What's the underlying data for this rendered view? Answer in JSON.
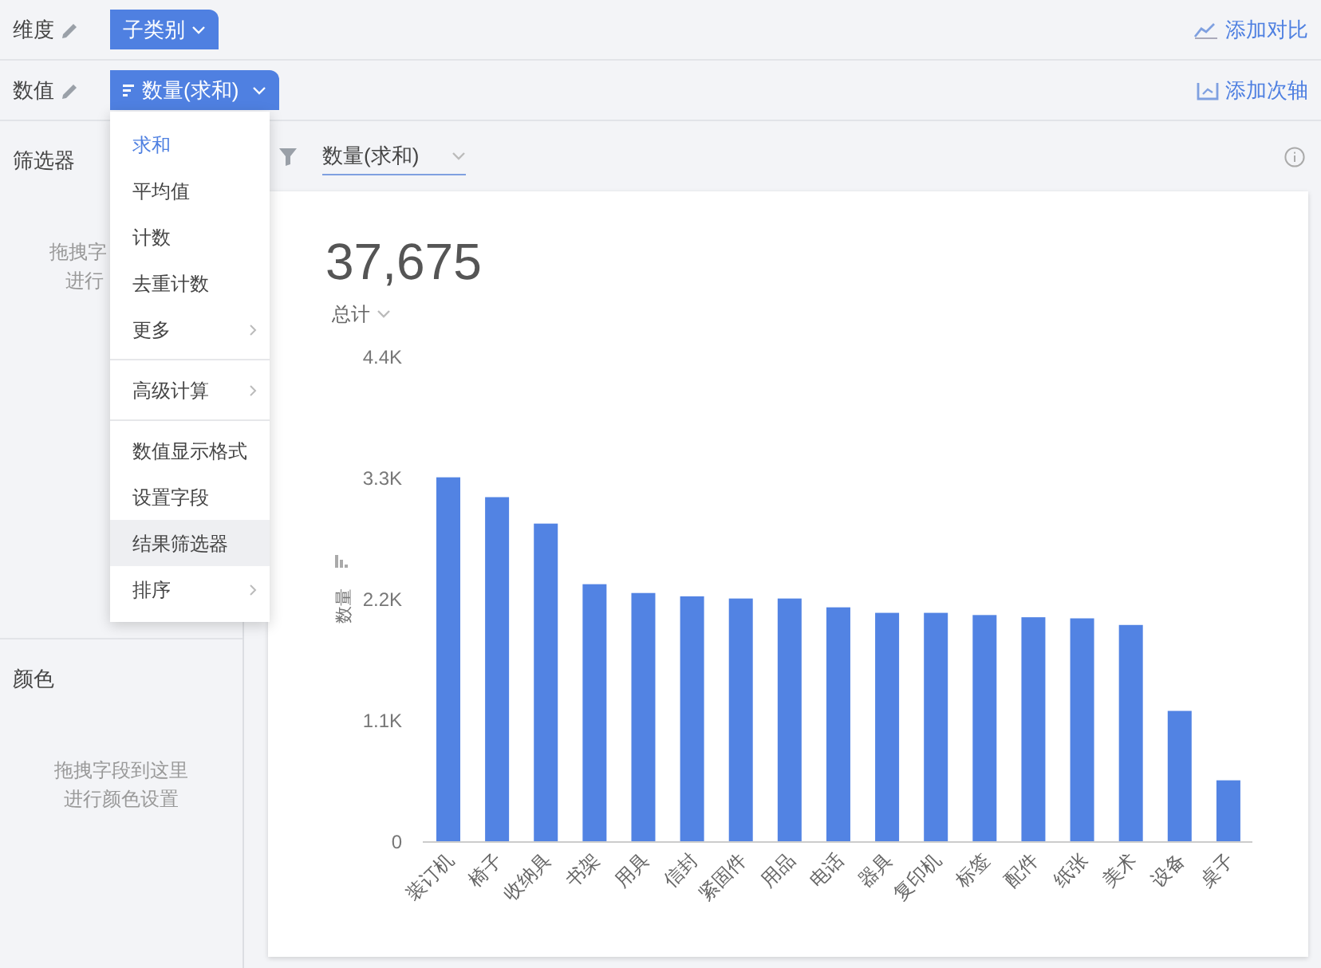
{
  "shelf_rows": [
    {
      "label": "维度",
      "field": "子类别",
      "field_icon": false,
      "action": "添加对比",
      "kind": "compare"
    },
    {
      "label": "数值",
      "field": "数量(求和)",
      "field_icon": true,
      "action": "添加次轴",
      "kind": "axis"
    }
  ],
  "menu": {
    "groups": [
      [
        {
          "label": "求和",
          "selected": true,
          "hovered": false,
          "submenu": false
        },
        {
          "label": "平均值",
          "selected": false,
          "hovered": false,
          "submenu": false
        },
        {
          "label": "计数",
          "selected": false,
          "hovered": false,
          "submenu": false
        },
        {
          "label": "去重计数",
          "selected": false,
          "hovered": false,
          "submenu": false
        },
        {
          "label": "更多",
          "selected": false,
          "hovered": false,
          "submenu": true
        }
      ],
      [
        {
          "label": "高级计算",
          "selected": false,
          "hovered": false,
          "submenu": true
        }
      ],
      [
        {
          "label": "数值显示格式",
          "selected": false,
          "hovered": false,
          "submenu": false
        },
        {
          "label": "设置字段",
          "selected": false,
          "hovered": false,
          "submenu": false
        },
        {
          "label": "结果筛选器",
          "selected": false,
          "hovered": true,
          "submenu": false
        },
        {
          "label": "排序",
          "selected": false,
          "hovered": false,
          "submenu": true
        }
      ]
    ]
  },
  "sidebar": {
    "sections": [
      {
        "title": "筛选器",
        "hint": [
          "拖拽字",
          "进行"
        ]
      },
      {
        "title": "颜色",
        "hint": [
          "拖拽字段到这里",
          "进行颜色设置"
        ]
      }
    ]
  },
  "filter_bar": {
    "field": "数量(求和)"
  },
  "card": {
    "total": "37,675",
    "total_label": "总计",
    "chart_data": {
      "type": "bar",
      "ylabel": "数量",
      "categories": [
        "装订机",
        "椅子",
        "收纳具",
        "书架",
        "用具",
        "信封",
        "紧固件",
        "用品",
        "电话",
        "器具",
        "复印机",
        "标签",
        "配件",
        "纸张",
        "美术",
        "设备",
        "桌子"
      ],
      "values": [
        3310,
        3130,
        2890,
        2340,
        2260,
        2230,
        2210,
        2210,
        2130,
        2080,
        2080,
        2060,
        2040,
        2030,
        1970,
        1190,
        560
      ],
      "ylim": [
        0,
        4400
      ],
      "yticks": [
        {
          "value": 0,
          "label": "0"
        },
        {
          "value": 1100,
          "label": "1.1K"
        },
        {
          "value": 2200,
          "label": "2.2K"
        },
        {
          "value": 3300,
          "label": "3.3K"
        },
        {
          "value": 4400,
          "label": "4.4K"
        }
      ]
    }
  }
}
